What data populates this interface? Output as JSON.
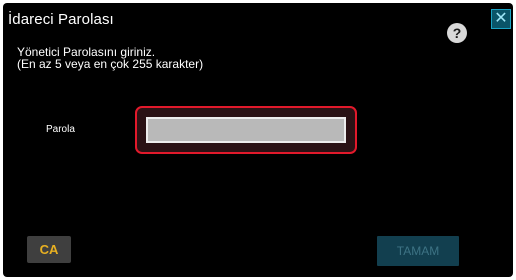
{
  "dialog": {
    "title": "İdareci Parolası",
    "help_label": "?",
    "close_label": "✕",
    "instruction_line1": "Yönetici Parolasını giriniz.",
    "instruction_line2": "(En az 5 veya en çok 255 karakter)"
  },
  "password_field": {
    "label": "Parola",
    "value": ""
  },
  "buttons": {
    "clear_label": "CA",
    "ok_label": "TAMAM"
  },
  "colors": {
    "focus_border": "#e2192b",
    "clear_text": "#e8b021",
    "ok_disabled": "#123f4f"
  }
}
